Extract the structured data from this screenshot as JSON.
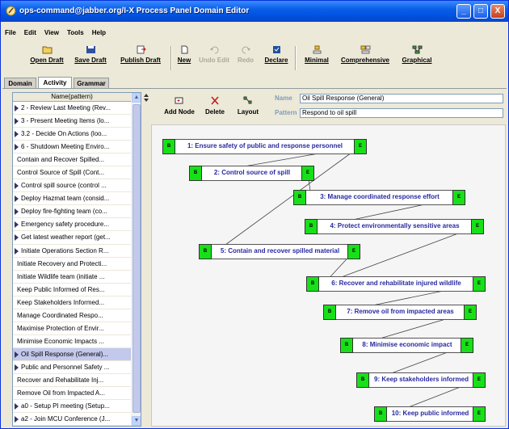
{
  "window": {
    "title": "ops-command@jabber.org/I-X Process Panel Domain Editor",
    "controls": [
      "_",
      "□",
      "X"
    ]
  },
  "menu": [
    "File",
    "Edit",
    "View",
    "Tools",
    "Help"
  ],
  "toolbar": {
    "open_draft": "Open Draft",
    "save_draft": "Save Draft",
    "publish_draft": "Publish Draft",
    "new": "New",
    "undo_edit": "Undo Edit",
    "redo": "Redo",
    "declare": "Declare",
    "minimal": "Minimal",
    "comprehensive": "Comprehensive",
    "graphical": "Graphical"
  },
  "tabs": [
    "Domain",
    "Activity",
    "Grammar"
  ],
  "list": {
    "header": "Name(pattern)",
    "items": [
      "2 - Review Last Meeting (Rev...",
      "3 - Present Meeting Items (lo...",
      "3.2 - Decide On Actions (loo...",
      "6 - Shutdown Meeting Enviro...",
      "Contain and Recover Spilled...",
      "Control Source of Spill (Cont...",
      "Control spill source (control ...",
      "Deploy Hazmat team (consid...",
      "Deploy fire-fighting team (co...",
      "Emergency safety procedure...",
      "Get latest weather report (get...",
      "Initiate Operations Section R...",
      "Initiate Recovery and Protecti...",
      "Initiate Wildlife team (initiate ...",
      "Keep Public Informed of Res...",
      "Keep Stakeholders Informed...",
      "Manage Coordinated Respo...",
      "Maximise Protection of Envir...",
      "Minimise Economic Impacts ...",
      "Oil Spill Response (General)...",
      "Public and Personnel Safety ...",
      "Recover and Rehabilitate Inj...",
      "Remove Oil from Impacted A...",
      "a0 - Setup PI meeting (Setup...",
      "a2 - Join MCU Conference (J..."
    ]
  },
  "editor": {
    "add_node": "Add Node",
    "delete": "Delete",
    "layout": "Layout",
    "name_label": "Name",
    "name_value": "Oil Spill Response (General)",
    "pattern_label": "Pattern",
    "pattern_value": "Respond to oil spill"
  },
  "nodes": [
    {
      "label": "1: Ensure safety of public and response personnel"
    },
    {
      "label": "2: Control source of spill"
    },
    {
      "label": "3: Manage coordinated response effort"
    },
    {
      "label": "4: Protect environmentally sensitive areas"
    },
    {
      "label": "5: Contain and recover spilled material"
    },
    {
      "label": "6: Recover and rehabilitate injured wildlife"
    },
    {
      "label": "7: Remove oil from impacted areas"
    },
    {
      "label": "8: Minimise economic impact"
    },
    {
      "label": "9: Keep stakeholders informed"
    },
    {
      "label": "10: Keep public informed"
    }
  ],
  "node_begin": "B",
  "node_end": "E",
  "colors": {
    "node_end": "#18e018",
    "node_text": "#2828a0",
    "title_bar": "#0a5ee8",
    "selection": "#c3c9ec"
  }
}
